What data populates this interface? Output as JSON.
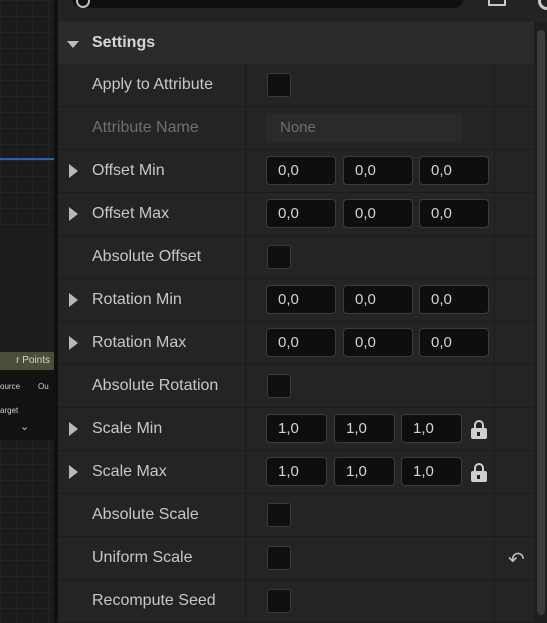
{
  "graph": {
    "node_title": "r Points",
    "pin_source": "ource",
    "pin_out": "Ou",
    "pin_target": "arget",
    "expand_glyph": "⌄"
  },
  "details": {
    "section_title": "Settings",
    "rows": [
      {
        "label": "Apply to Attribute",
        "control": "checkbox",
        "checked": false
      },
      {
        "label": "Attribute Name",
        "control": "text",
        "value": "None",
        "disabled": true
      },
      {
        "label": "Offset Min",
        "control": "vector",
        "values": [
          "0,0",
          "0,0",
          "0,0"
        ]
      },
      {
        "label": "Offset Max",
        "control": "vector",
        "values": [
          "0,0",
          "0,0",
          "0,0"
        ]
      },
      {
        "label": "Absolute Offset",
        "control": "checkbox",
        "checked": false
      },
      {
        "label": "Rotation Min",
        "control": "vector",
        "values": [
          "0,0",
          "0,0",
          "0,0"
        ]
      },
      {
        "label": "Rotation Max",
        "control": "vector",
        "values": [
          "0,0",
          "0,0",
          "0,0"
        ]
      },
      {
        "label": "Absolute Rotation",
        "control": "checkbox",
        "checked": false
      },
      {
        "label": "Scale Min",
        "control": "vector-lock",
        "values": [
          "1,0",
          "1,0",
          "1,0"
        ]
      },
      {
        "label": "Scale Max",
        "control": "vector-lock",
        "values": [
          "1,0",
          "1,0",
          "1,0"
        ]
      },
      {
        "label": "Absolute Scale",
        "control": "checkbox",
        "checked": false
      },
      {
        "label": "Uniform Scale",
        "control": "checkbox",
        "checked": false,
        "reset": true
      },
      {
        "label": "Recompute Seed",
        "control": "checkbox",
        "checked": false
      }
    ]
  },
  "icons": {
    "reset_glyph": "↶"
  }
}
